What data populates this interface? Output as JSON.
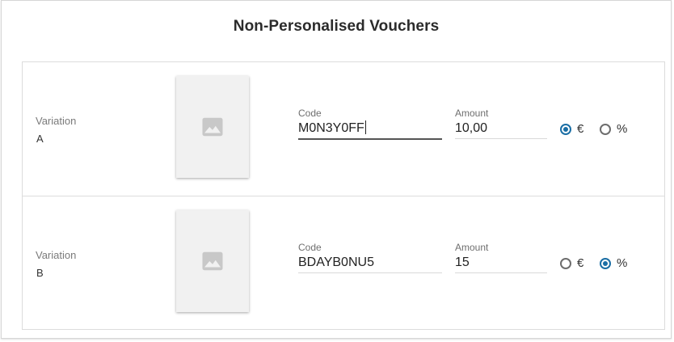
{
  "title": "Non-Personalised Vouchers",
  "colors": {
    "accent": "#1a6ea5",
    "thumbnail_bg": "#f1f1f1",
    "placeholder_icon": "#c8c8c8"
  },
  "rows": [
    {
      "variation_label": "Variation",
      "variation_value": "A",
      "thumbnail_icon": "image-placeholder-icon",
      "code_label": "Code",
      "code_value": "M0N3Y0FF",
      "amount_label": "Amount",
      "amount_value": "10,00",
      "option_euro": "€",
      "option_percent": "%",
      "selected": "euro"
    },
    {
      "variation_label": "Variation",
      "variation_value": "B",
      "thumbnail_icon": "image-placeholder-icon",
      "code_label": "Code",
      "code_value": "BDAYB0NU5",
      "amount_label": "Amount",
      "amount_value": "15",
      "option_euro": "€",
      "option_percent": "%",
      "selected": "percent"
    }
  ]
}
